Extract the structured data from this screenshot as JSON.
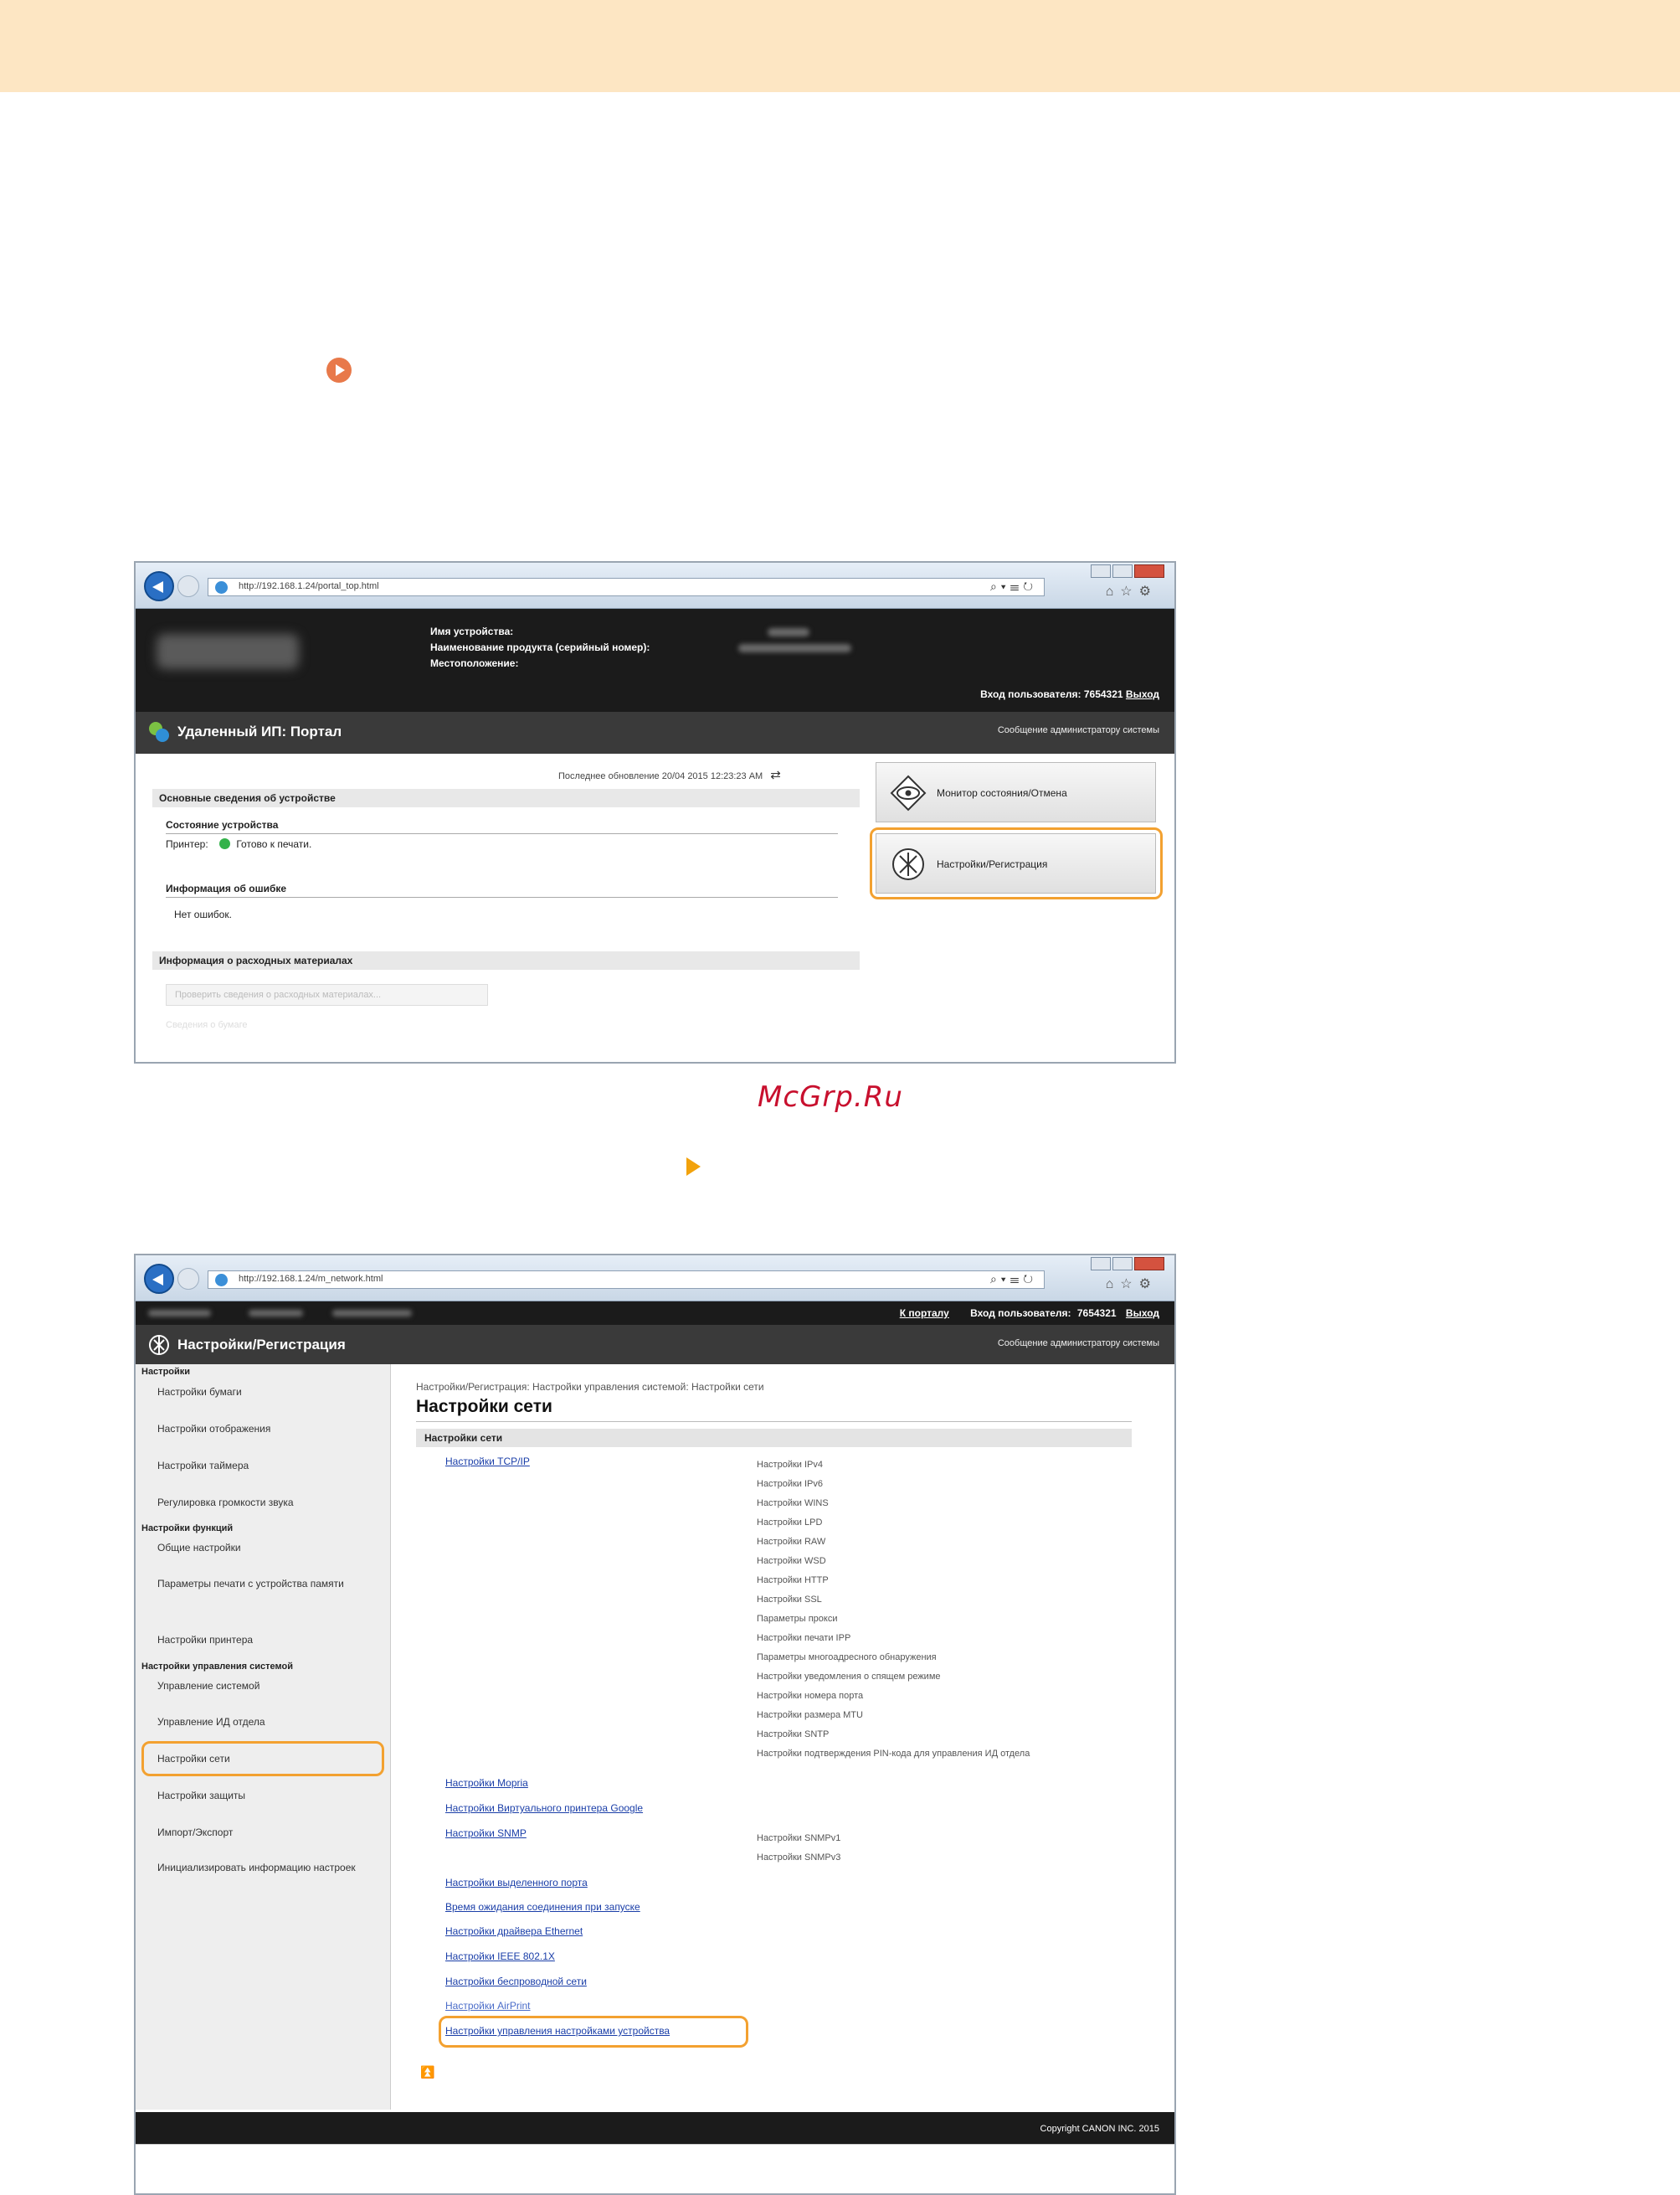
{
  "page": {
    "watermark": "McGrp.Ru"
  },
  "window_portal": {
    "url": "http://192.168.1.24/portal_top.html",
    "header": {
      "labels": [
        "Имя устройства:",
        "Наименование продукта (серийный номер):",
        "Местоположение:"
      ],
      "login_label": "Вход пользователя:",
      "login_user": "7654321",
      "logout": "Выход"
    },
    "title": "Удаленный ИП: Портал",
    "admin_message": "Сообщение администратору системы",
    "last_update": "Последнее обновление 20/04 2015 12:23:23 AM",
    "device_info_header": "Основные сведения об устройстве",
    "device_status_label": "Состояние устройства",
    "printer_label": "Принтер:",
    "printer_status": "Готово к печати.",
    "error_info_label": "Информация об ошибке",
    "error_info_value": "Нет ошибок.",
    "consumables_header": "Информация о расходных материалах",
    "check_consumables_button": "Проверить сведения о расходных материалах...",
    "faded_text": "Сведения о бумаге",
    "side_buttons": [
      "Монитор состояния/Отмена",
      "Настройки/Регистрация"
    ]
  },
  "window_settings": {
    "url": "http://192.168.1.24/m_network.html",
    "header": {
      "to_portal": "К порталу",
      "login_label": "Вход пользователя:",
      "login_user": "7654321",
      "logout": "Выход"
    },
    "title": "Настройки/Регистрация",
    "admin_message": "Сообщение администратору системы",
    "sidebar": {
      "cat_settings": "Настройки",
      "paper": "Настройки бумаги",
      "display": "Настройки отображения",
      "timer": "Настройки таймера",
      "volume": "Регулировка громкости звука",
      "cat_functions": "Настройки функций",
      "common": "Общие настройки",
      "memory_print": "Параметры печати с устройства памяти",
      "printer": "Настройки принтера",
      "cat_management": "Настройки управления системой",
      "system_mgmt": "Управление системой",
      "dept_id": "Управление ИД отдела",
      "network": "Настройки сети",
      "security": "Настройки защиты",
      "import_export": "Импорт/Экспорт",
      "init_settings": "Инициализировать информацию настроек"
    },
    "breadcrumb": "Настройки/Регистрация: Настройки управления системой: Настройки сети",
    "page_title": "Настройки сети",
    "section_bar": "Настройки сети",
    "links": {
      "tcpip": "Настройки TCP/IP",
      "mopria": "Настройки Mopria",
      "google": "Настройки Виртуального принтера Google",
      "snmp": "Настройки SNMP",
      "dedicated_port": "Настройки выделенного порта",
      "startup_wait": "Время ожидания соединения при запуске",
      "ethernet": "Настройки драйвера Ethernet",
      "ieee": "Настройки IEEE 802.1X",
      "wireless": "Настройки беспроводной сети",
      "airprint": "Настройки AirPrint",
      "device_mgmt": "Настройки управления настройками устройства"
    },
    "tcpip_items": [
      "Настройки IPv4",
      "Настройки IPv6",
      "Настройки WINS",
      "Настройки LPD",
      "Настройки RAW",
      "Настройки WSD",
      "Настройки HTTP",
      "Настройки SSL",
      "Параметры прокси",
      "Настройки печати IPP",
      "Параметры многоадресного обнаружения",
      "Настройки уведомления о спящем режиме",
      "Настройки номера порта",
      "Настройки размера MTU",
      "Настройки SNTP",
      "Настройки подтверждения PIN-кода для управления ИД отдела"
    ],
    "snmp_items": [
      "Настройки SNMPv1",
      "Настройки SNMPv3"
    ],
    "to_top": "⏫",
    "copyright": "Copyright CANON INC. 2015"
  },
  "colors": {
    "top_band": "#fde6c3",
    "highlight": "#f3a130",
    "watermark": "#c8102e",
    "link": "#1a3ea8",
    "header_dark": "#1b1b1b"
  },
  "icons": [
    "step-marker-icon",
    "arrow-marker-icon",
    "back-icon",
    "forward-icon",
    "ie-icon",
    "refresh-icon",
    "portal-logo-icon",
    "status-monitor-icon",
    "settings-icon",
    "to-top-icon"
  ]
}
